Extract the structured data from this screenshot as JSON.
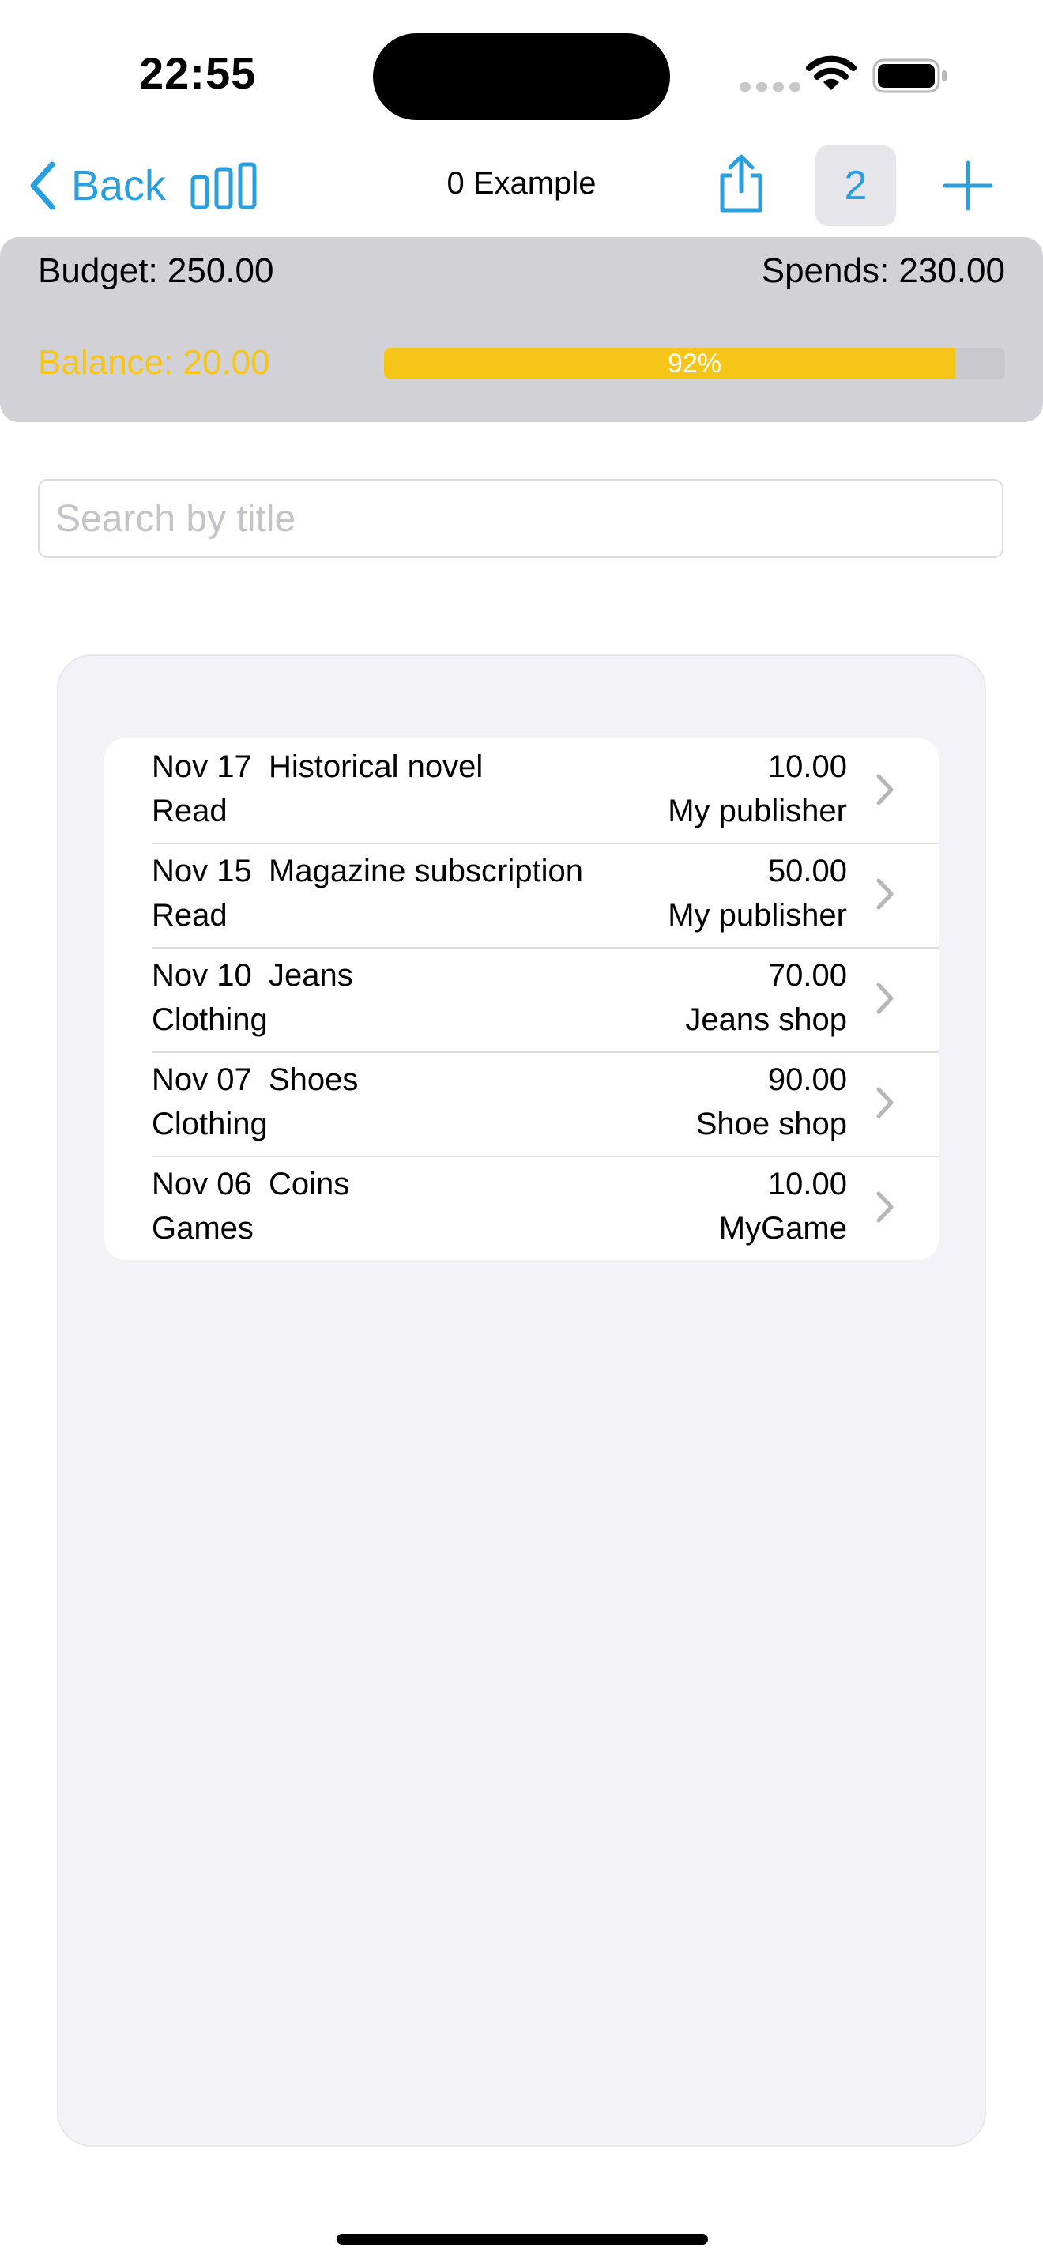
{
  "status_bar": {
    "time": "22:55"
  },
  "nav": {
    "back_label": "Back",
    "title": "0 Example",
    "badge": "2",
    "accent_color": "#2a9fe0"
  },
  "budget": {
    "budget_text": "Budget: 250.00",
    "spends_text": "Spends: 230.00",
    "balance_text": "Balance:  20.00",
    "progress_percent": 92,
    "progress_label": "92%",
    "balance_color": "#f5c518"
  },
  "search": {
    "placeholder": "Search by title",
    "value": ""
  },
  "expenses": [
    {
      "date": "Nov 17",
      "title": "Historical novel",
      "category": "Read",
      "amount": "10.00",
      "shop": "My publisher"
    },
    {
      "date": "Nov 15",
      "title": "Magazine subscription",
      "category": "Read",
      "amount": "50.00",
      "shop": "My publisher"
    },
    {
      "date": "Nov 10",
      "title": "Jeans",
      "category": "Clothing",
      "amount": "70.00",
      "shop": "Jeans shop"
    },
    {
      "date": "Nov 07",
      "title": "Shoes",
      "category": "Clothing",
      "amount": "90.00",
      "shop": "Shoe shop"
    },
    {
      "date": "Nov 06",
      "title": "Coins",
      "category": "Games",
      "amount": "10.00",
      "shop": "MyGame"
    }
  ]
}
